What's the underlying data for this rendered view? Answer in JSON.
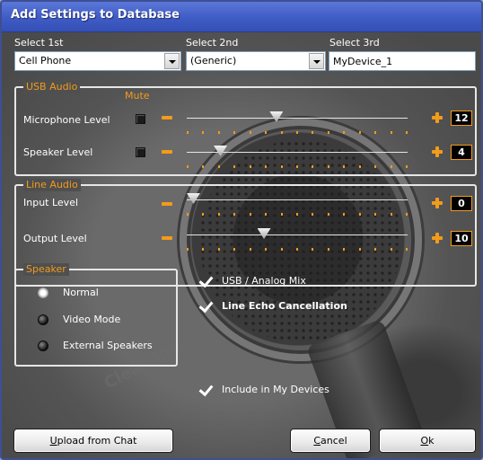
{
  "window": {
    "title": "Add Settings to Database"
  },
  "selectors": {
    "first": {
      "label": "Select 1st",
      "value": "Cell Phone"
    },
    "second": {
      "label": "Select 2nd",
      "value": "(Generic)"
    },
    "third": {
      "label": "Select 3rd",
      "value": "MyDevice_1"
    }
  },
  "usb_audio": {
    "title": "USB Audio",
    "mute_label": "Mute",
    "microphone": {
      "label": "Microphone Level",
      "value": "12",
      "level": 0.4
    },
    "speaker": {
      "label": "Speaker Level",
      "value": "4",
      "level": 0.13
    }
  },
  "line_audio": {
    "title": "Line Audio",
    "input": {
      "label": "Input Level",
      "value": "0",
      "level": 0.0
    },
    "output": {
      "label": "Output Level",
      "value": "10",
      "level": 0.34
    }
  },
  "speaker": {
    "title": "Speaker",
    "options": [
      {
        "label": "Normal",
        "selected": true
      },
      {
        "label": "Video Mode",
        "selected": false
      },
      {
        "label": "External Speakers",
        "selected": false
      }
    ]
  },
  "checks": {
    "usb_analog_mix": {
      "label": "USB / Analog Mix",
      "checked": true
    },
    "line_echo": {
      "label": "Line Echo Cancellation",
      "checked": true
    },
    "include_devices": {
      "label": "Include in My Devices",
      "checked": true
    }
  },
  "buttons": {
    "upload": {
      "mnemonic": "U",
      "rest": "pload from Chat"
    },
    "cancel": {
      "mnemonic": "C",
      "rest": "ancel"
    },
    "ok": {
      "mnemonic": "O",
      "rest": "k"
    }
  },
  "background": {
    "watermark": "ClearOne"
  },
  "colors": {
    "accent": "#f39b1a",
    "titlebar": "#3f5cc5",
    "panel": "#4f4f4f"
  }
}
